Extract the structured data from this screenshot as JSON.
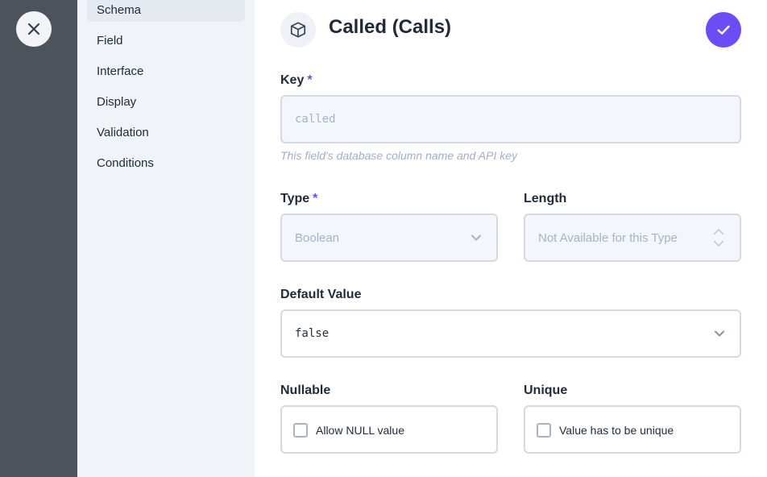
{
  "nav": {
    "items": [
      {
        "label": "Schema",
        "active": true
      },
      {
        "label": "Field",
        "active": false
      },
      {
        "label": "Interface",
        "active": false
      },
      {
        "label": "Display",
        "active": false
      },
      {
        "label": "Validation",
        "active": false
      },
      {
        "label": "Conditions",
        "active": false
      }
    ]
  },
  "header": {
    "title": "Called (Calls)",
    "icon": "box-icon",
    "save_icon": "check-icon",
    "close_icon": "close-icon"
  },
  "form": {
    "key": {
      "label": "Key",
      "required_mark": "*",
      "value": "called",
      "hint": "This field's database column name and API key"
    },
    "type": {
      "label": "Type",
      "required_mark": "*",
      "value": "Boolean"
    },
    "length": {
      "label": "Length",
      "placeholder": "Not Available for this Type"
    },
    "default_value": {
      "label": "Default Value",
      "value": "false"
    },
    "nullable": {
      "label": "Nullable",
      "checkbox_label": "Allow NULL value",
      "checked": false
    },
    "unique": {
      "label": "Unique",
      "checkbox_label": "Value has to be unique",
      "checked": false
    }
  },
  "colors": {
    "accent": "#6b4cf6",
    "overlay": "#4d535b",
    "nav_bg": "#f0f3f7"
  }
}
